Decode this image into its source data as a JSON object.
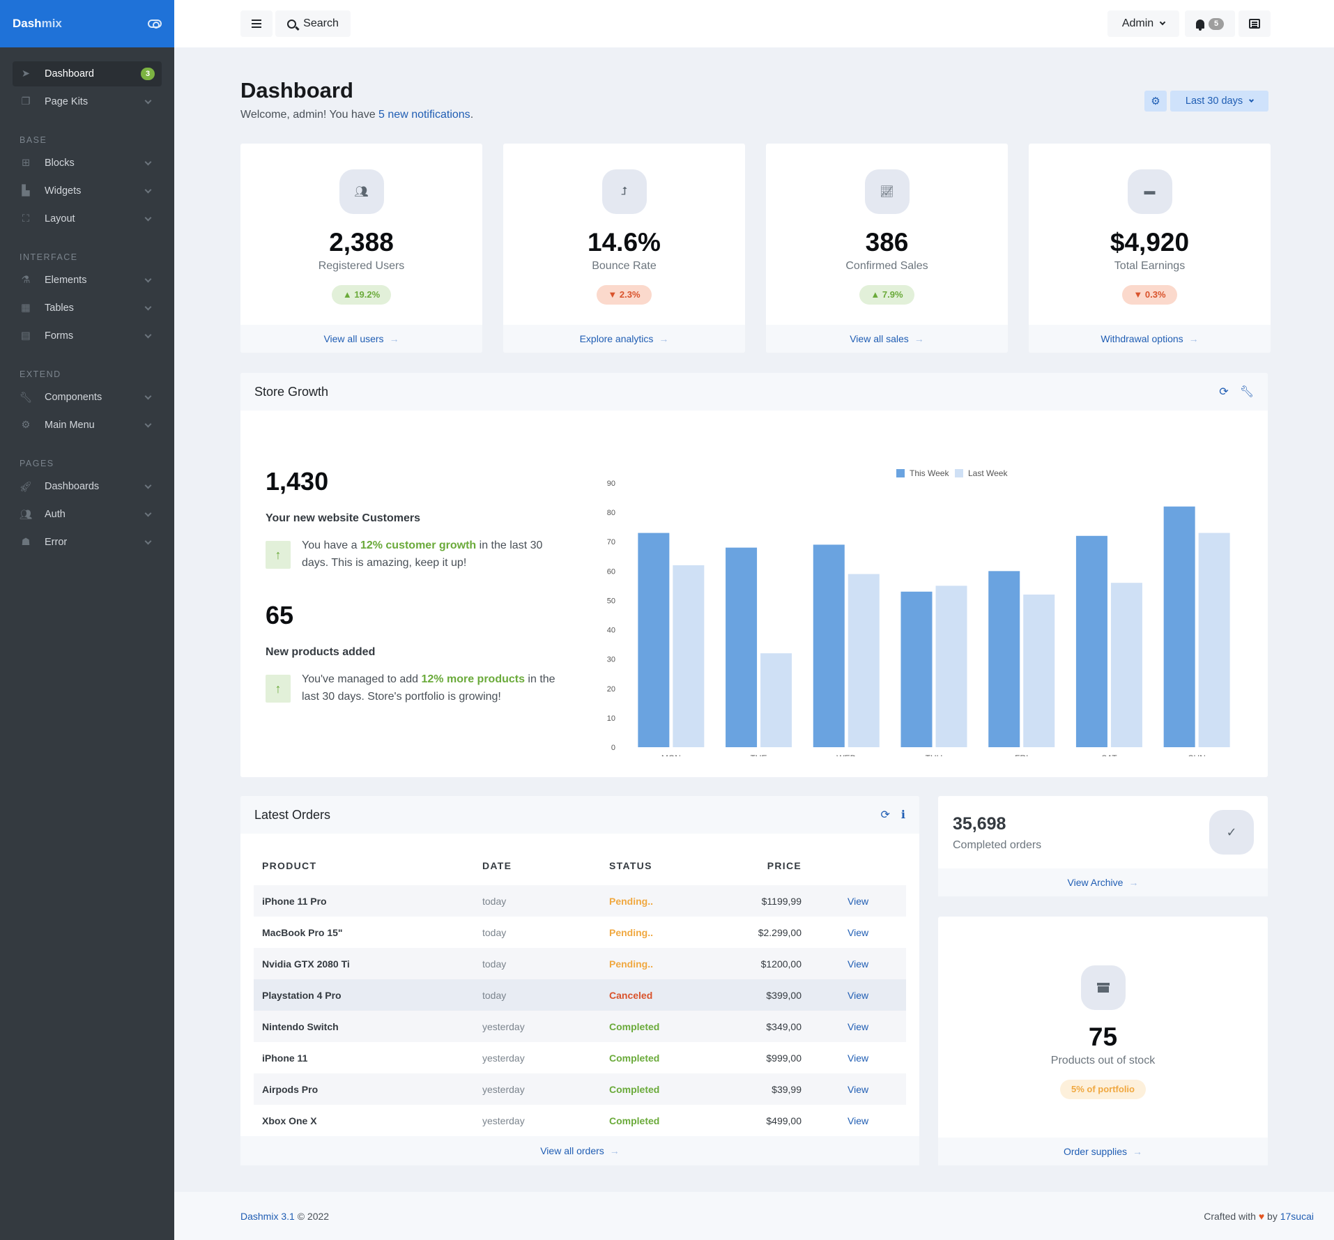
{
  "brand": {
    "name_a": "Dash",
    "name_b": "mix"
  },
  "sidebar": {
    "dashboard": {
      "label": "Dashboard",
      "badge": "3"
    },
    "page_kits": {
      "label": "Page Kits"
    },
    "sections": [
      {
        "heading": "BASE",
        "items": [
          {
            "label": "Blocks",
            "icon": "grid-icon"
          },
          {
            "label": "Widgets",
            "icon": "cubes-icon"
          },
          {
            "label": "Layout",
            "icon": "vector-square-icon"
          }
        ]
      },
      {
        "heading": "INTERFACE",
        "items": [
          {
            "label": "Elements",
            "icon": "flask-icon"
          },
          {
            "label": "Tables",
            "icon": "table-icon"
          },
          {
            "label": "Forms",
            "icon": "file-form-icon"
          }
        ]
      },
      {
        "heading": "EXTEND",
        "items": [
          {
            "label": "Components",
            "icon": "wrench-icon"
          },
          {
            "label": "Main Menu",
            "icon": "gear-icon"
          }
        ]
      },
      {
        "heading": "PAGES",
        "items": [
          {
            "label": "Dashboards",
            "icon": "rocket-icon"
          },
          {
            "label": "Auth",
            "icon": "users-icon"
          },
          {
            "label": "Error",
            "icon": "ghost-icon"
          }
        ]
      }
    ]
  },
  "header": {
    "search_label": "Search",
    "user_label": "Admin",
    "notifications_count": "5"
  },
  "page": {
    "title": "Dashboard",
    "welcome_prefix": "Welcome, admin! You have ",
    "welcome_link": "5 new notifications",
    "welcome_suffix": ".",
    "range_label": "Last 30 days"
  },
  "stats": [
    {
      "value": "2,388",
      "label": "Registered Users",
      "change": "19.2%",
      "trend": "up",
      "link": "View all users",
      "icon": "users-icon"
    },
    {
      "value": "14.6%",
      "label": "Bounce Rate",
      "change": "2.3%",
      "trend": "down",
      "link": "Explore analytics",
      "icon": "level-up-icon"
    },
    {
      "value": "386",
      "label": "Confirmed Sales",
      "change": "7.9%",
      "trend": "up",
      "link": "View all sales",
      "icon": "chart-line-icon"
    },
    {
      "value": "$4,920",
      "label": "Total Earnings",
      "change": "0.3%",
      "trend": "down",
      "link": "Withdrawal options",
      "icon": "wallet-icon"
    }
  ],
  "growth": {
    "title": "Store Growth",
    "customers": {
      "value": "1,430",
      "label": "Your new website Customers",
      "text_a": "You have a ",
      "highlight": "12% customer growth",
      "text_b": " in the last 30 days. This is amazing, keep it up!"
    },
    "products": {
      "value": "65",
      "label": "New products added",
      "text_a": "You've managed to add ",
      "highlight": "12% more products",
      "text_b": " in the last 30 days. Store's portfolio is growing!"
    }
  },
  "chart_data": {
    "type": "bar",
    "title": "",
    "xlabel": "",
    "ylabel": "",
    "categories": [
      "MON",
      "TUE",
      "WED",
      "THU",
      "FRI",
      "SAT",
      "SUN"
    ],
    "series": [
      {
        "name": "This Week",
        "color": "#6aa3e0",
        "values": [
          73,
          68,
          69,
          53,
          60,
          72,
          82
        ]
      },
      {
        "name": "Last Week",
        "color": "#cfe0f5",
        "values": [
          62,
          32,
          59,
          55,
          52,
          56,
          73
        ]
      }
    ],
    "ylim": [
      0,
      90
    ],
    "yticks": [
      0,
      10,
      20,
      30,
      40,
      50,
      60,
      70,
      80,
      90
    ],
    "grid": false,
    "legend": "top-center"
  },
  "orders": {
    "title": "Latest Orders",
    "columns": [
      "PRODUCT",
      "DATE",
      "STATUS",
      "PRICE"
    ],
    "rows": [
      {
        "product": "iPhone 11 Pro",
        "date": "today",
        "status": "Pending..",
        "status_type": "pending",
        "price": "$1199,99",
        "action": "View"
      },
      {
        "product": "MacBook Pro 15\"",
        "date": "today",
        "status": "Pending..",
        "status_type": "pending",
        "price": "$2.299,00",
        "action": "View"
      },
      {
        "product": "Nvidia GTX 2080 Ti",
        "date": "today",
        "status": "Pending..",
        "status_type": "pending",
        "price": "$1200,00",
        "action": "View"
      },
      {
        "product": "Playstation 4 Pro",
        "date": "today",
        "status": "Canceled",
        "status_type": "canceled",
        "price": "$399,00",
        "action": "View"
      },
      {
        "product": "Nintendo Switch",
        "date": "yesterday",
        "status": "Completed",
        "status_type": "completed",
        "price": "$349,00",
        "action": "View"
      },
      {
        "product": "iPhone 11",
        "date": "yesterday",
        "status": "Completed",
        "status_type": "completed",
        "price": "$999,00",
        "action": "View"
      },
      {
        "product": "Airpods Pro",
        "date": "yesterday",
        "status": "Completed",
        "status_type": "completed",
        "price": "$39,99",
        "action": "View"
      },
      {
        "product": "Xbox One X",
        "date": "yesterday",
        "status": "Completed",
        "status_type": "completed",
        "price": "$499,00",
        "action": "View"
      }
    ],
    "footer_link": "View all orders"
  },
  "completed_orders": {
    "value": "35,698",
    "label": "Completed orders",
    "link": "View Archive"
  },
  "stock": {
    "value": "75",
    "label": "Products out of stock",
    "badge": "5% of portfolio",
    "link": "Order supplies"
  },
  "footer": {
    "product": "Dashmix 3.1",
    "copyright": " © 2022",
    "crafted": "Crafted with ",
    "by": " by ",
    "author": "17sucai"
  }
}
